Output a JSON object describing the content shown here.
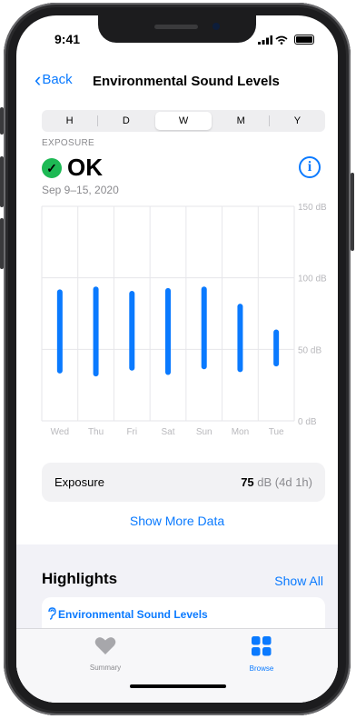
{
  "status": {
    "time": "9:41",
    "signal_icon": "cellular-bars-icon",
    "wifi_icon": "wifi-icon",
    "battery_icon": "battery-icon"
  },
  "nav": {
    "back_label": "Back",
    "title": "Environmental Sound Levels"
  },
  "segments": [
    "H",
    "D",
    "W",
    "M",
    "Y"
  ],
  "selected_segment": "W",
  "exposure": {
    "label": "EXPOSURE",
    "status": "OK",
    "date_range": "Sep 9–15, 2020"
  },
  "colors": {
    "accent": "#0a7aff",
    "ok_green": "#1db954",
    "bar": "#0a7aff"
  },
  "chart_data": {
    "type": "bar",
    "categories": [
      "Wed",
      "Thu",
      "Fri",
      "Sat",
      "Sun",
      "Mon",
      "Tue"
    ],
    "series": [
      {
        "min": [
          35,
          33,
          37,
          34,
          38,
          36,
          40
        ],
        "max": [
          90,
          92,
          89,
          91,
          92,
          80,
          62
        ]
      }
    ],
    "y_tick_labels": [
      "150 dB",
      "100 dB",
      "50 dB",
      "0 dB"
    ],
    "ylim": [
      0,
      150
    ],
    "grid": true
  },
  "summary": {
    "label": "Exposure",
    "value": "75",
    "unit_detail": " dB (4d 1h)"
  },
  "show_more_label": "Show More Data",
  "highlights": {
    "title": "Highlights",
    "show_all_label": "Show All",
    "item_label": "Environmental Sound Levels",
    "item_icon": "ear-icon"
  },
  "tabbar": {
    "summary_label": "Summary",
    "browse_label": "Browse",
    "summary_icon": "heart-icon",
    "browse_icon": "grid-icon"
  }
}
